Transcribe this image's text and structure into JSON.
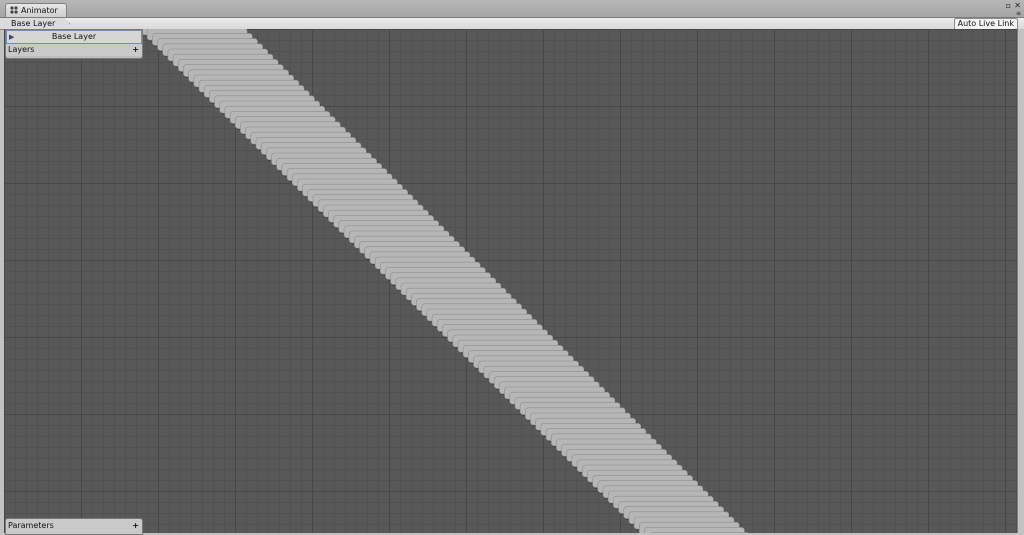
{
  "window": {
    "tab_title": "Animator"
  },
  "toolbar": {
    "breadcrumb": "Base Layer",
    "auto_live_link": "Auto Live Link"
  },
  "layers": {
    "header": "Layers",
    "items": [
      {
        "label": "Base Layer",
        "selected": true
      }
    ]
  },
  "parameters": {
    "header": "Parameters"
  },
  "icons": {
    "tab": "animator-icon",
    "add_layer": "plus-icon",
    "add_parameter": "plus-icon",
    "maximize": "maximize-icon",
    "close": "close-icon",
    "menu": "menu-icon",
    "layer_expand": "triangle-right-icon"
  },
  "colors": {
    "graph_bg": "#585858",
    "node_fill": "#b6b6b6",
    "selection": "#6f8fb8"
  }
}
